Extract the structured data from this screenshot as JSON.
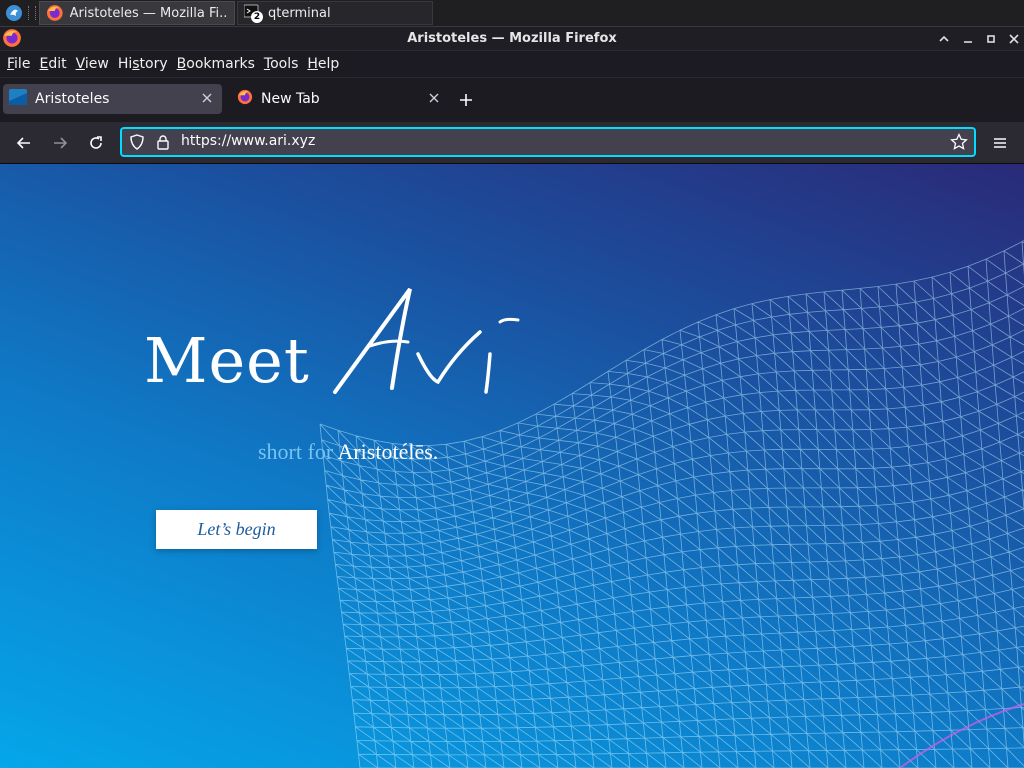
{
  "taskbar": {
    "tasks": [
      {
        "label": "Aristoteles — Mozilla Fi...",
        "icon": "firefox-icon"
      },
      {
        "label": "qterminal",
        "icon": "terminal-icon",
        "badge": "2"
      }
    ]
  },
  "window": {
    "title": "Aristoteles — Mozilla Firefox"
  },
  "menubar": {
    "items": [
      {
        "pre": "",
        "acc": "F",
        "post": "ile"
      },
      {
        "pre": "",
        "acc": "E",
        "post": "dit"
      },
      {
        "pre": "",
        "acc": "V",
        "post": "iew"
      },
      {
        "pre": "Hi",
        "acc": "s",
        "post": "tory"
      },
      {
        "pre": "",
        "acc": "B",
        "post": "ookmarks"
      },
      {
        "pre": "",
        "acc": "T",
        "post": "ools"
      },
      {
        "pre": "",
        "acc": "H",
        "post": "elp"
      }
    ]
  },
  "tabs": [
    {
      "label": "Aristoteles",
      "selected": true
    },
    {
      "label": "New Tab",
      "selected": false
    }
  ],
  "navbar": {
    "url": "https://www.ari.xyz"
  },
  "page": {
    "headline": "Meet",
    "logo_word": "Avi",
    "sub_prefix": "short for",
    "sub_name": "Aristotélēs.",
    "cta": "Let’s begin"
  },
  "colors": {
    "accent": "#00ddff",
    "gradient_top": "#2a2a78",
    "gradient_bottom": "#05a6ea"
  }
}
